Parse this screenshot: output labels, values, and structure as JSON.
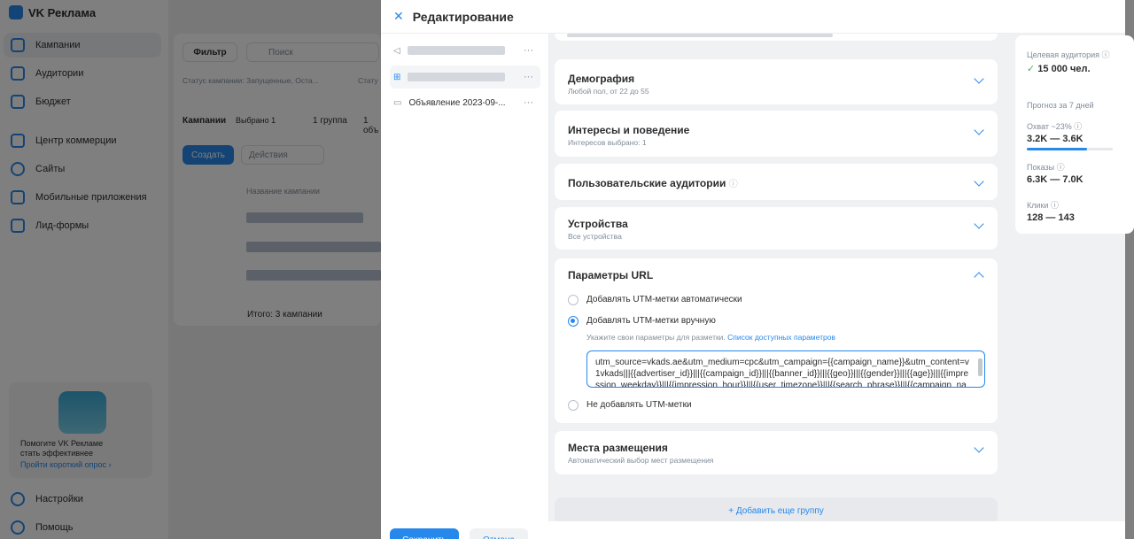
{
  "app": {
    "logo": "VK Реклама",
    "nav": [
      {
        "label": "Кампании"
      },
      {
        "label": "Аудитории"
      },
      {
        "label": "Бюджет"
      },
      {
        "label": "Центр коммерции"
      },
      {
        "label": "Сайты"
      },
      {
        "label": "Мобильные приложения"
      },
      {
        "label": "Лид-формы"
      }
    ],
    "promo": {
      "text1": "Помогите VK Рекламе",
      "text2": "стать эффективнее",
      "link": "Пройти короткий опрос ›"
    },
    "settings": "Настройки",
    "help": "Помощь",
    "filter_btn": "Фильтр",
    "search_placeholder": "Поиск",
    "status_chip": "Статус кампании: Запущенные, Оста...",
    "status_chip2": "Стату",
    "tab_campaigns": "Кампании",
    "selected": "Выбрано 1",
    "tab_group": "1 группа",
    "tab_ad": "1 объ",
    "create_btn": "Создать",
    "actions_btn": "Действия",
    "col_name": "Название кампании",
    "total": "Итого: 3 кампании"
  },
  "modal": {
    "title": "Редактирование",
    "tree": [
      {
        "label": ""
      },
      {
        "label": ""
      },
      {
        "label": "Объявление 2023-09-..."
      }
    ],
    "sections": {
      "demography": {
        "title": "Демография",
        "subtitle": "Любой пол, от 22 до 55"
      },
      "interests": {
        "title": "Интересы и поведение",
        "subtitle": "Интересов выбрано: 1"
      },
      "custom_aud": {
        "title": "Пользовательские аудитории"
      },
      "devices": {
        "title": "Устройства",
        "subtitle": "Все устройства"
      },
      "url_params": {
        "title": "Параметры URL",
        "opt_auto": "Добавлять UTM-метки автоматически",
        "opt_manual": "Добавлять UTM-метки вручную",
        "hint": "Укажите свои параметры для разметки.",
        "hint_link": "Список доступных параметров",
        "utm_value": "utm_source=vkads.ae&utm_medium=cpc&utm_campaign={{campaign_name}}&utm_content=v1vkads|||{{advertiser_id}}|||{{campaign_id}}|||{{banner_id}}|||{{geo}}|||{{gender}}|||{{age}}|||{{impression_weekday}}|||{{impression_hour}}|||{{user_timezone}}|||{{search_phrase}}|||{{campaign_na",
        "opt_none": "Не добавлять UTM-метки"
      },
      "placements": {
        "title": "Места размещения",
        "subtitle": "Автоматический выбор мест размещения"
      }
    },
    "add_group": "+ Добавить еще группу",
    "save_btn": "Сохранить",
    "cancel_btn": "Отмена",
    "forecast": {
      "audience_label": "Целевая аудитория",
      "audience_value": "15 000 чел.",
      "period": "Прогноз за 7 дней",
      "reach_label": "Охват ~23%",
      "reach_value": "3.2K — 3.6K",
      "reach_progress": 0.7,
      "views_label": "Показы",
      "views_value": "6.3K — 7.0K",
      "clicks_label": "Клики",
      "clicks_value": "128 — 143"
    }
  }
}
